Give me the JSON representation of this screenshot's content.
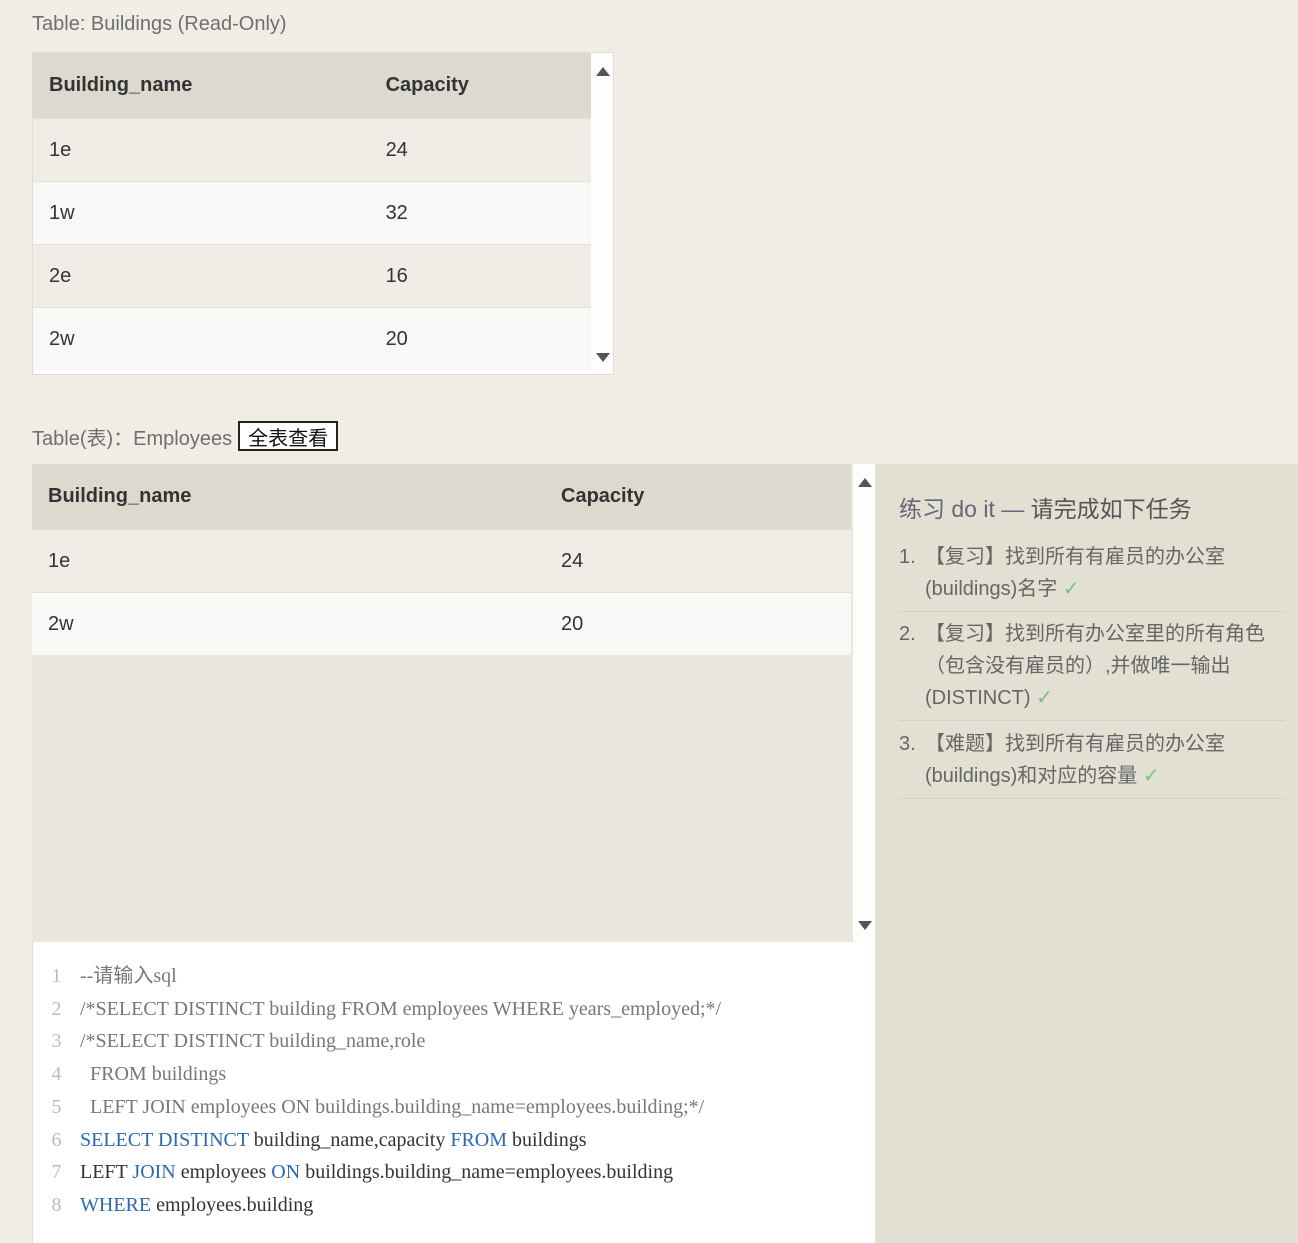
{
  "buildings_section": {
    "caption": "Table: Buildings (Read-Only)",
    "columns": [
      "Building_name",
      "Capacity"
    ],
    "rows": [
      [
        "1e",
        "24"
      ],
      [
        "1w",
        "32"
      ],
      [
        "2e",
        "16"
      ],
      [
        "2w",
        "20"
      ]
    ]
  },
  "employees_section": {
    "caption": "Table(表)：Employees",
    "view_all_button": "全表查看",
    "columns": [
      "Building_name",
      "Capacity"
    ],
    "rows": [
      [
        "1e",
        "24"
      ],
      [
        "2w",
        "20"
      ]
    ]
  },
  "editor": {
    "lines": [
      [
        {
          "t": "--请输入sql",
          "c": "cm"
        }
      ],
      [
        {
          "t": "/*SELECT DISTINCT building FROM employees WHERE years_employed;*/",
          "c": "cm"
        }
      ],
      [
        {
          "t": "/*SELECT DISTINCT building_name,role",
          "c": "cm"
        }
      ],
      [
        {
          "t": "  FROM buildings",
          "c": "cm"
        }
      ],
      [
        {
          "t": "  LEFT JOIN employees ON buildings.building_name=employees.building;*/",
          "c": "cm"
        }
      ],
      [
        {
          "t": "SELECT",
          "c": "kw"
        },
        {
          "t": " ",
          "c": "tx"
        },
        {
          "t": "DISTINCT",
          "c": "kw"
        },
        {
          "t": " building_name,capacity ",
          "c": "tx"
        },
        {
          "t": "FROM",
          "c": "kw"
        },
        {
          "t": " buildings",
          "c": "tx"
        }
      ],
      [
        {
          "t": "LEFT ",
          "c": "tx"
        },
        {
          "t": "JOIN",
          "c": "kw"
        },
        {
          "t": " employees ",
          "c": "tx"
        },
        {
          "t": "ON",
          "c": "kw"
        },
        {
          "t": " buildings.building_name=employees.building",
          "c": "tx"
        }
      ],
      [
        {
          "t": "WHERE",
          "c": "kw"
        },
        {
          "t": " employees.building",
          "c": "tx"
        }
      ]
    ]
  },
  "tasks": {
    "title_prefix": "练习 do it — ",
    "title_main": "请完成如下任务",
    "items": [
      {
        "num": "1.",
        "text": "【复习】找到所有有雇员的办公室(buildings)名字",
        "check": "✓"
      },
      {
        "num": "2.",
        "text": "【复习】找到所有办公室里的所有角色（包含没有雇员的）,并做唯一输出(DISTINCT)",
        "check": "✓"
      },
      {
        "num": "3.",
        "text": "【难题】找到所有有雇员的办公室(buildings)和对应的容量",
        "check": "✓"
      }
    ]
  },
  "colors": {
    "page_bg": "#f0ede5",
    "header_bg": "#dcdacf",
    "keyword": "#2a6ab3",
    "check": "#7fbf7f"
  }
}
